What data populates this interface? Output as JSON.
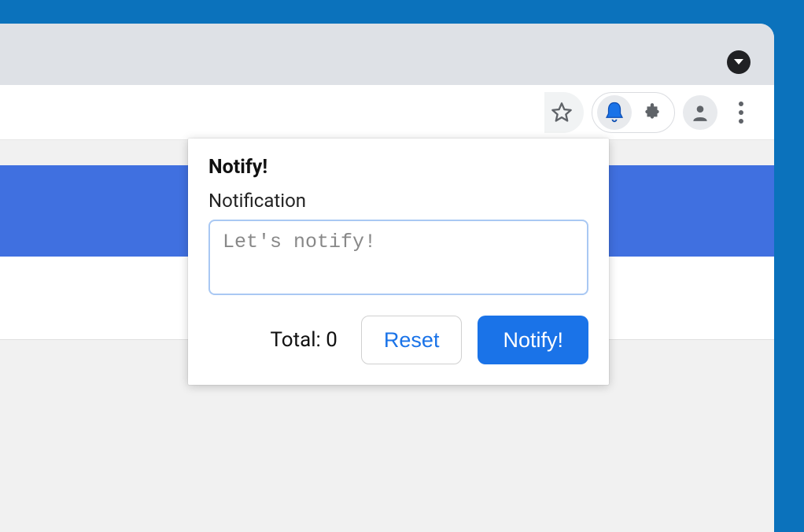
{
  "colors": {
    "accent": "#1a73e8",
    "banner": "#4070e0",
    "desktop": "#0b72bc"
  },
  "toolbar": {
    "star_icon": "star-icon",
    "bell_icon": "bell-icon",
    "puzzle_icon": "puzzle-icon",
    "avatar_icon": "avatar-icon",
    "menu_icon": "menu-icon"
  },
  "popup": {
    "title": "Notify!",
    "label": "Notification",
    "placeholder": "Let's notify!",
    "total_label": "Total: ",
    "total_value": "0",
    "reset_label": "Reset",
    "notify_label": "Notify!"
  }
}
